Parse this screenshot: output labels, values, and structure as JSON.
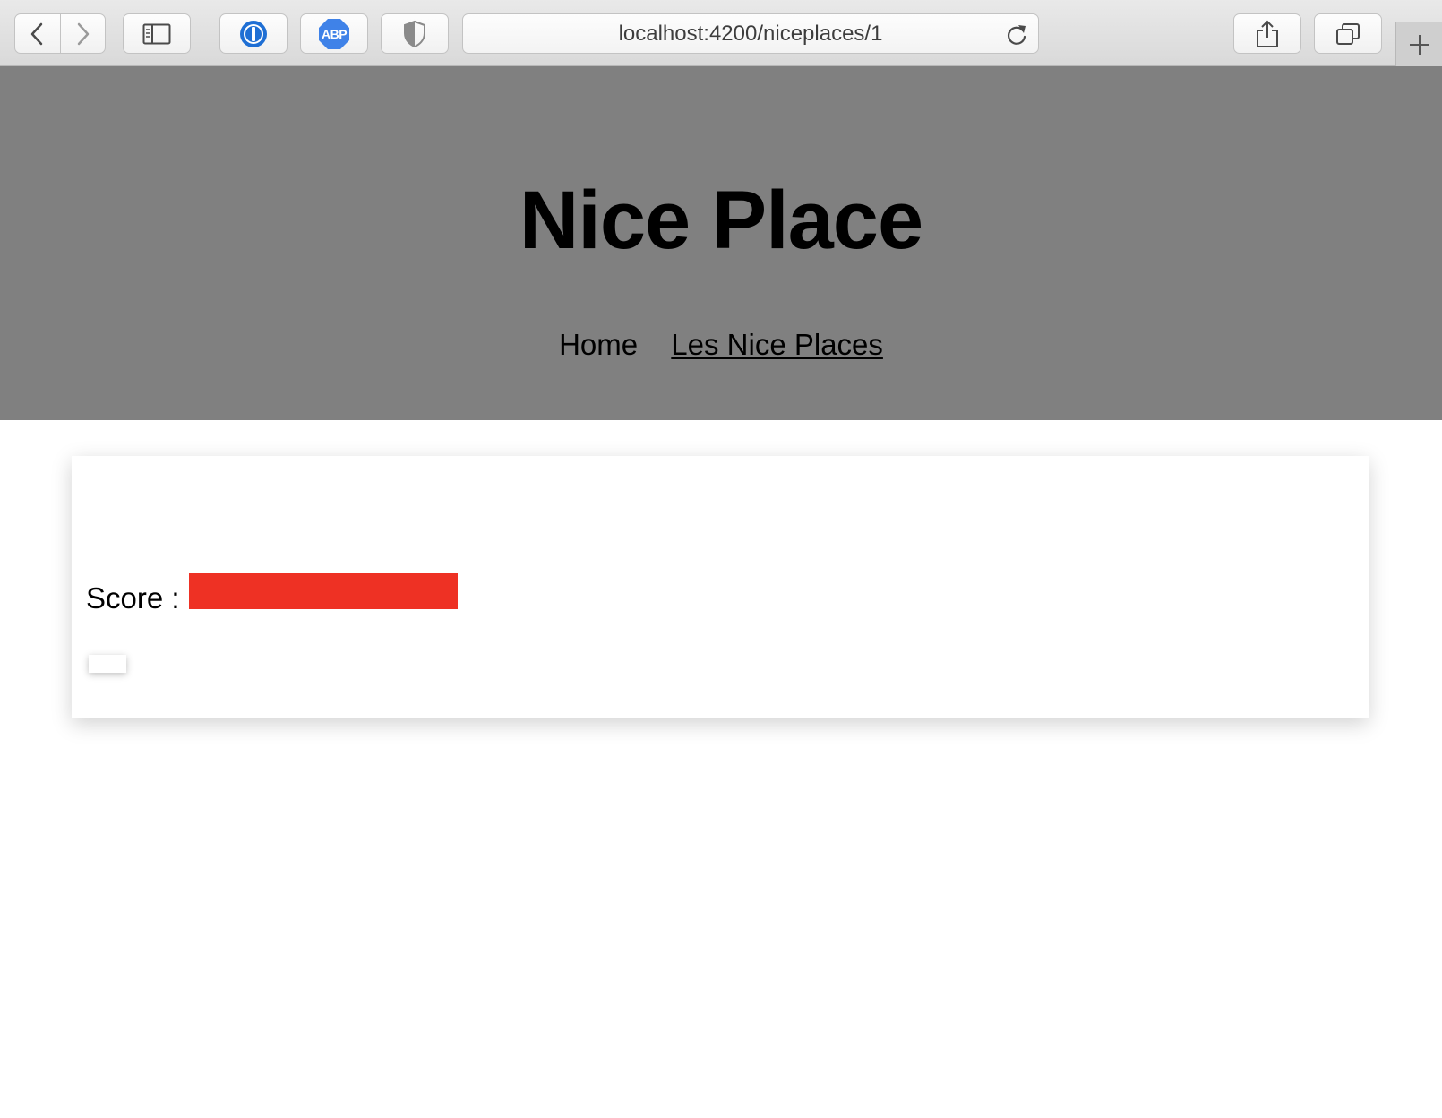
{
  "browser": {
    "url": "localhost:4200/niceplaces/1",
    "icons": {
      "back": "chevron-left-icon",
      "forward": "chevron-right-icon",
      "sidebar": "sidebar-icon",
      "password_manager": "1password-icon",
      "adblock": "adblock-icon",
      "privacy": "shield-icon",
      "reload": "reload-icon",
      "share": "share-icon",
      "tabs": "tabs-overview-icon",
      "new_tab": "plus-icon"
    },
    "adblock_label": "ABP"
  },
  "header": {
    "title": "Nice Place",
    "nav": [
      {
        "label": "Home",
        "active": false
      },
      {
        "label": "Les Nice Places",
        "active": true
      }
    ],
    "background": "#808080"
  },
  "card": {
    "score_label": "Score :",
    "score_fraction": 1.0,
    "score_color": "#ee3124"
  }
}
